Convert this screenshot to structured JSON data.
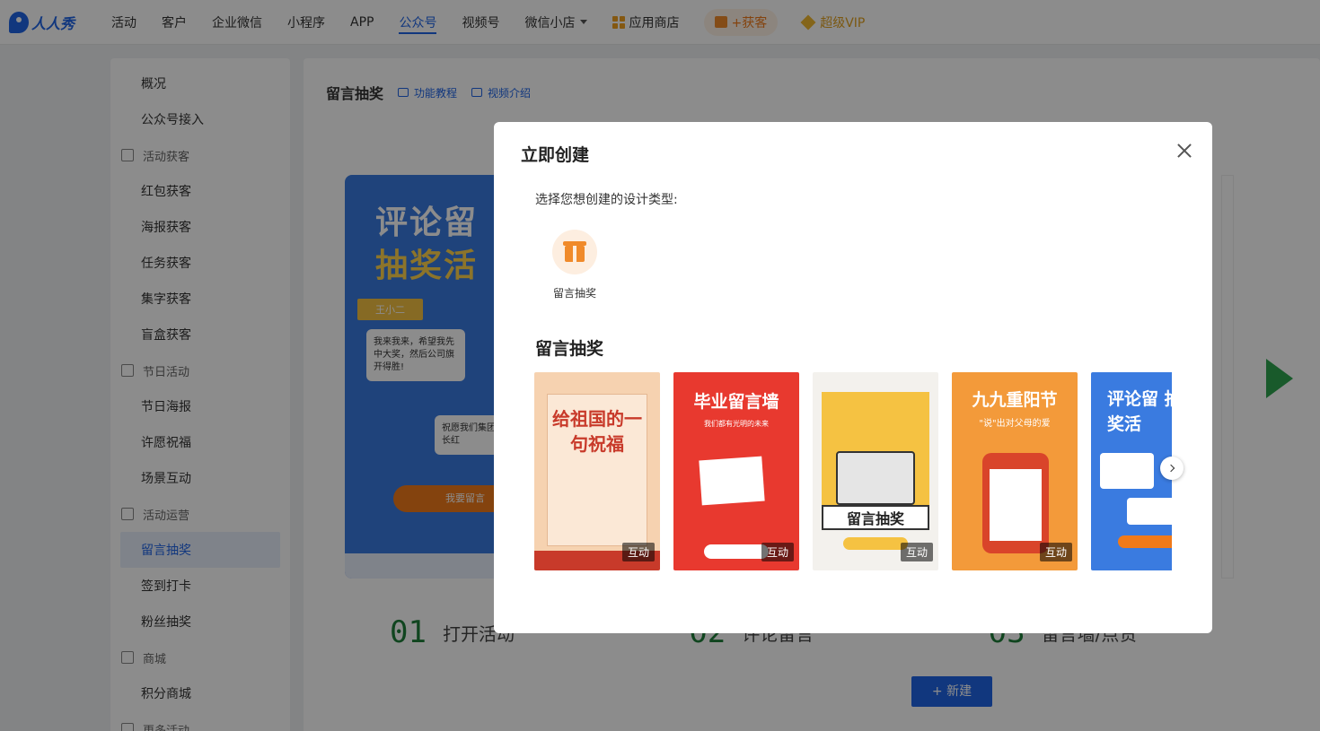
{
  "nav": {
    "logo": "人人秀",
    "items": [
      {
        "label": "活动"
      },
      {
        "label": "客户"
      },
      {
        "label": "企业微信"
      },
      {
        "label": "小程序"
      },
      {
        "label": "APP"
      },
      {
        "label": "公众号"
      },
      {
        "label": "视频号"
      },
      {
        "label": "微信小店"
      }
    ],
    "active": "公众号",
    "app_store": "应用商店",
    "get_customers": "+获客",
    "vip": "超级VIP"
  },
  "sidebar": {
    "items": [
      {
        "type": "item",
        "label": "概况"
      },
      {
        "type": "item",
        "label": "公众号接入"
      },
      {
        "type": "group",
        "label": "活动获客"
      },
      {
        "type": "item",
        "label": "红包获客"
      },
      {
        "type": "item",
        "label": "海报获客"
      },
      {
        "type": "item",
        "label": "任务获客"
      },
      {
        "type": "item",
        "label": "集字获客"
      },
      {
        "type": "item",
        "label": "盲盒获客"
      },
      {
        "type": "group",
        "label": "节日活动"
      },
      {
        "type": "item",
        "label": "节日海报"
      },
      {
        "type": "item",
        "label": "许愿祝福"
      },
      {
        "type": "item",
        "label": "场景互动"
      },
      {
        "type": "group",
        "label": "活动运营"
      },
      {
        "type": "item",
        "label": "留言抽奖"
      },
      {
        "type": "item",
        "label": "签到打卡"
      },
      {
        "type": "item",
        "label": "粉丝抽奖"
      },
      {
        "type": "group",
        "label": "商城"
      },
      {
        "type": "item",
        "label": "积分商城"
      },
      {
        "type": "group",
        "label": "更多活动"
      }
    ],
    "active": "留言抽奖"
  },
  "main": {
    "title": "留言抽奖",
    "tutorial_link": "功能教程",
    "video_link": "视频介绍",
    "poster": {
      "title_line1": "评论留",
      "title_line2": "抽奖活",
      "tag": "王小二",
      "bubble1": "我来我来，希望我先中大奖，然后公司旗开得胜!",
      "bubble2": "祝愿我们集团意，股票长红",
      "button": "我要留言"
    },
    "steps": [
      {
        "num": "01",
        "label": "打开活动"
      },
      {
        "num": "02",
        "label": "评论留言"
      },
      {
        "num": "03",
        "label": "留言墙/点赞"
      }
    ],
    "new_button": "+ 新建"
  },
  "modal": {
    "title": "立即创建",
    "prompt": "选择您想创建的设计类型:",
    "type_label": "留言抽奖",
    "section_title": "留言抽奖",
    "templates": [
      {
        "title": "给祖国的一句祝福",
        "badge": "互动",
        "bg": "#f6d2b0",
        "accent": "#c83a2a"
      },
      {
        "title": "毕业留言墙",
        "subtitle": "我们都有光明的未来",
        "badge": "互动",
        "bg": "#e8392f",
        "accent": "#ffffff"
      },
      {
        "title": "留言抽奖",
        "badge": "互动",
        "bg": "#f3f1ed",
        "accent": "#f5c242"
      },
      {
        "title": "九九重阳节",
        "subtitle": "\"说\"出对父母的爱",
        "badge": "互动",
        "bg": "#f39a3a",
        "accent": "#ffffff"
      },
      {
        "title": "评论留 抽奖活",
        "badge": "",
        "bg": "#3a7be0",
        "accent": "#ffd34d"
      }
    ]
  }
}
